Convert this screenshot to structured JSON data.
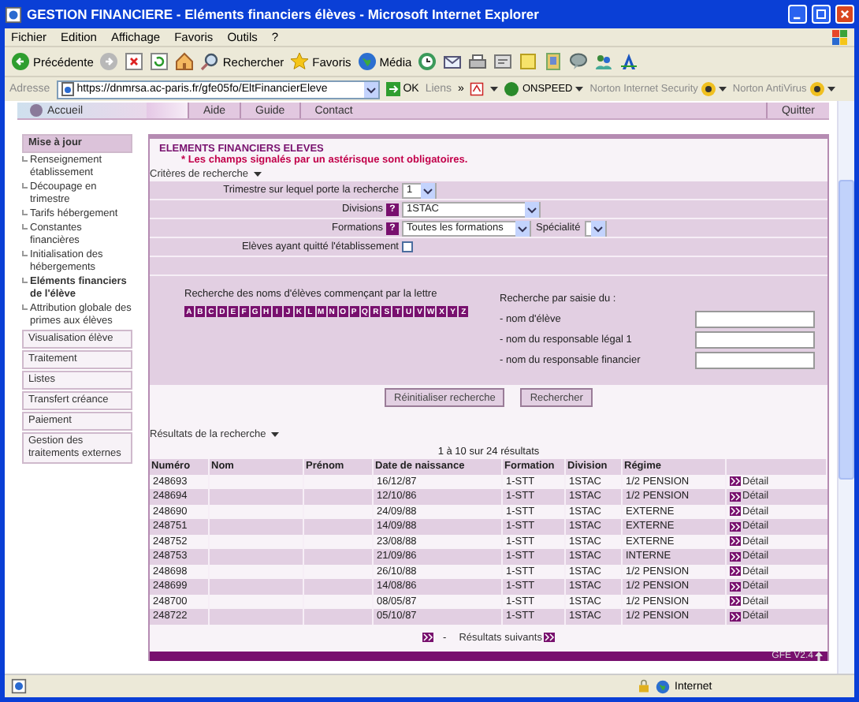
{
  "window": {
    "title": "GESTION FINANCIERE - Eléments financiers élèves - Microsoft Internet Explorer"
  },
  "menu": [
    "Fichier",
    "Edition",
    "Affichage",
    "Favoris",
    "Outils",
    "?"
  ],
  "toolbar": [
    {
      "kind": "back",
      "label": "Précédente"
    },
    {
      "kind": "forward"
    },
    {
      "kind": "stop"
    },
    {
      "kind": "refresh"
    },
    {
      "kind": "home"
    },
    {
      "kind": "search",
      "label": "Rechercher"
    },
    {
      "kind": "favorites",
      "label": "Favoris"
    },
    {
      "kind": "media",
      "label": "Média"
    },
    {
      "kind": "history"
    },
    {
      "kind": "mail"
    },
    {
      "kind": "print"
    },
    {
      "kind": "edit"
    },
    {
      "kind": "note"
    },
    {
      "kind": "research"
    },
    {
      "kind": "messenger"
    },
    {
      "kind": "contacts"
    },
    {
      "kind": "font"
    }
  ],
  "address": {
    "label": "Adresse",
    "url": "https://dnmrsa.ac-paris.fr/gfe05fo/EltFinancierEleve",
    "go": "OK",
    "links": "Liens",
    "more": "»",
    "addons": [
      "ONSPEED",
      "Norton Internet Security",
      "Norton AntiVirus"
    ]
  },
  "nav": {
    "home": "Accueil",
    "items": [
      "Aide",
      "Guide",
      "Contact"
    ],
    "quit": "Quitter"
  },
  "sidebar": [
    {
      "label": "Mise à jour",
      "expanded": true,
      "children": [
        {
          "label": "Renseignement établissement",
          "selected": false
        },
        {
          "label": "Découpage en trimestre",
          "selected": false
        },
        {
          "label": "Tarifs hébergement",
          "selected": false
        },
        {
          "label": "Constantes financières",
          "selected": false
        },
        {
          "label": "Initialisation des hébergements",
          "selected": false
        },
        {
          "label": "Eléments financiers de l'élève",
          "selected": true
        },
        {
          "label": "Attribution globale des primes aux élèves",
          "selected": false
        }
      ]
    },
    {
      "label": "Visualisation élève",
      "expanded": false
    },
    {
      "label": "Traitement",
      "expanded": false
    },
    {
      "label": "Listes",
      "expanded": false
    },
    {
      "label": "Transfert créance",
      "expanded": false
    },
    {
      "label": "Paiement",
      "expanded": false
    },
    {
      "label": "Gestion des traitements externes",
      "expanded": false
    }
  ],
  "main": {
    "title": "ELEMENTS FINANCIERS ELEVES",
    "notice": "* Les champs signalés par un astérisque sont obligatoires.",
    "criteria_heading": "Critères de recherche",
    "criteria": [
      {
        "kind": "select",
        "label": "Trimestre sur lequel porte la recherche",
        "value": "1"
      },
      {
        "kind": "select",
        "label": "Divisions",
        "help": "?",
        "value": "1STAC"
      },
      {
        "kind": "select",
        "label": "Formations",
        "help": "?",
        "value": "Toutes les formations",
        "extra": "Spécialité"
      },
      {
        "kind": "checkbox",
        "label": "Elèves ayant quitté l'établissement",
        "checked": false
      },
      {
        "kind": "blank"
      }
    ],
    "letters_title": "Recherche des noms d'élèves commençant par la lettre",
    "letters": [
      "A",
      "B",
      "C",
      "D",
      "E",
      "F",
      "G",
      "H",
      "I",
      "J",
      "K",
      "L",
      "M",
      "N",
      "O",
      "P",
      "Q",
      "R",
      "S",
      "T",
      "U",
      "V",
      "W",
      "X",
      "Y",
      "Z"
    ],
    "text_search": {
      "title": "Recherche par saisie du :",
      "fields": [
        "- nom d'élève",
        "- nom du responsable légal 1",
        "- nom du responsable financier"
      ]
    },
    "buttons": [
      "Réinitialiser recherche",
      "Rechercher"
    ],
    "results_heading": "Résultats de la recherche",
    "summary": "1 à 10 sur 24 résultats",
    "columns": [
      "Numéro",
      "Nom",
      "Prénom",
      "Date de naissance",
      "Formation",
      "Division",
      "Régime"
    ],
    "rows": [
      {
        "cells": [
          "248693",
          "",
          "",
          "16/12/87",
          "1-STT",
          "1STAC",
          "1/2 PENSION"
        ],
        "link": "Détail"
      },
      {
        "cells": [
          "248694",
          "",
          "",
          "12/10/86",
          "1-STT",
          "1STAC",
          "1/2 PENSION"
        ],
        "link": "Détail"
      },
      {
        "cells": [
          "248690",
          "",
          "",
          "24/09/88",
          "1-STT",
          "1STAC",
          "EXTERNE"
        ],
        "link": "Détail"
      },
      {
        "cells": [
          "248751",
          "",
          "",
          "14/09/88",
          "1-STT",
          "1STAC",
          "EXTERNE"
        ],
        "link": "Détail"
      },
      {
        "cells": [
          "248752",
          "",
          "",
          "23/08/88",
          "1-STT",
          "1STAC",
          "EXTERNE"
        ],
        "link": "Détail"
      },
      {
        "cells": [
          "248753",
          "",
          "",
          "21/09/86",
          "1-STT",
          "1STAC",
          "INTERNE"
        ],
        "link": "Détail"
      },
      {
        "cells": [
          "248698",
          "",
          "",
          "26/10/88",
          "1-STT",
          "1STAC",
          "1/2 PENSION"
        ],
        "link": "Détail"
      },
      {
        "cells": [
          "248699",
          "",
          "",
          "14/08/86",
          "1-STT",
          "1STAC",
          "1/2 PENSION"
        ],
        "link": "Détail"
      },
      {
        "cells": [
          "248700",
          "",
          "",
          "08/05/87",
          "1-STT",
          "1STAC",
          "1/2 PENSION"
        ],
        "link": "Détail"
      },
      {
        "cells": [
          "248722",
          "",
          "",
          "05/10/87",
          "1-STT",
          "1STAC",
          "1/2 PENSION"
        ],
        "link": "Détail"
      }
    ],
    "pager": {
      "separator": "-",
      "next": "Résultats suivants"
    },
    "footer": "GFE V2.4"
  },
  "status": {
    "zone": "Internet"
  }
}
